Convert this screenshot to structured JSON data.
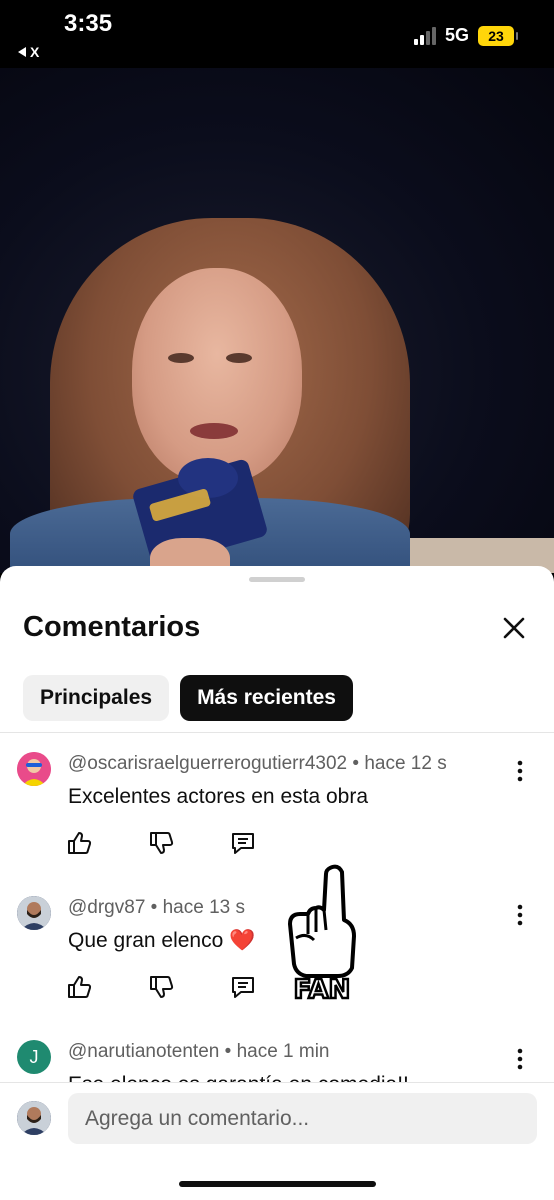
{
  "status": {
    "time": "3:35",
    "back_label": "X",
    "network": "5G",
    "battery": "23"
  },
  "sheet": {
    "title": "Comentarios",
    "tabs": [
      {
        "label": "Principales",
        "active": false
      },
      {
        "label": "Más recientes",
        "active": true
      }
    ]
  },
  "comments": [
    {
      "author": "@oscarisraelguerrerogutierr4302",
      "time": "hace 12 s",
      "text": "Excelentes actores en esta obra",
      "avatar_color": "#e94b8a"
    },
    {
      "author": "@drgv87",
      "time": "hace 13 s",
      "text": "Que gran elenco ❤️",
      "avatar_color": "#3b4a6b"
    },
    {
      "author": "@narutianotenten",
      "time": "hace 1 min",
      "text": "Ese elenco es garantía en comedia!!",
      "avatar_initial": "J",
      "avatar_color": "#1f8a70"
    }
  ],
  "overlay": {
    "fan_label": "FAN"
  },
  "composer": {
    "placeholder": "Agrega un comentario..."
  },
  "colors": {
    "accent": "#0f0f0f",
    "battery": "#ffd60a"
  }
}
